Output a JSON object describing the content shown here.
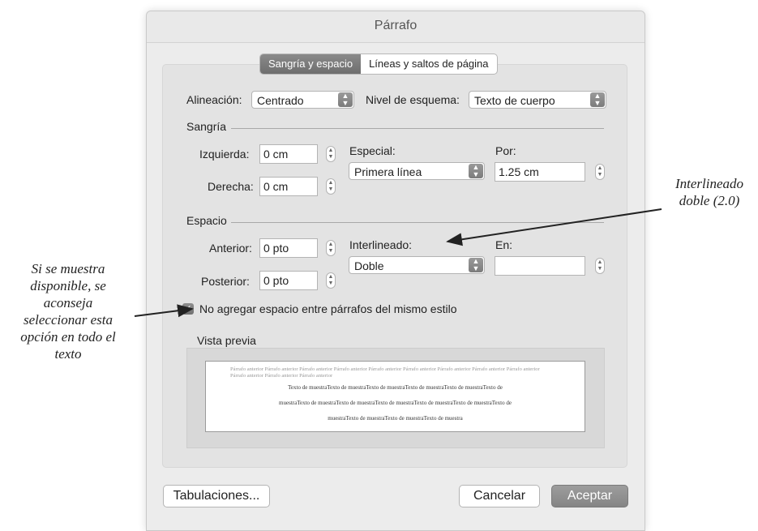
{
  "dialog": {
    "title": "Párrafo",
    "tabs": [
      {
        "label": "Sangría y espacio",
        "active": true
      },
      {
        "label": "Líneas y saltos de página",
        "active": false
      }
    ],
    "alignment": {
      "label": "Alineación:",
      "value": "Centrado"
    },
    "outline_level": {
      "label": "Nivel de esquema:",
      "value": "Texto de cuerpo"
    },
    "indentation": {
      "section": "Sangría",
      "left": {
        "label": "Izquierda:",
        "value": "0 cm"
      },
      "right": {
        "label": "Derecha:",
        "value": "0 cm"
      },
      "special": {
        "label": "Especial:",
        "value": "Primera línea"
      },
      "by": {
        "label": "Por:",
        "value": "1.25 cm"
      }
    },
    "spacing": {
      "section": "Espacio",
      "before": {
        "label": "Anterior:",
        "value": "0 pto"
      },
      "after": {
        "label": "Posterior:",
        "value": "0 pto"
      },
      "line_spacing": {
        "label": "Interlineado:",
        "value": "Doble"
      },
      "at": {
        "label": "En:",
        "value": ""
      }
    },
    "no_space_checkbox": {
      "label": "No agregar espacio entre párrafos del mismo estilo",
      "checked": true
    },
    "preview": {
      "label": "Vista previa",
      "prior_text": "Párrafo anterior Párrafo anterior Párrafo anterior Párrafo anterior Párrafo anterior Párrafo anterior Párrafo anterior Párrafo anterior Párrafo anterior Párrafo anterior Párrafo anterior Párrafo anterior",
      "sample_lines": [
        "Texto de muestraTexto de muestraTexto de muestraTexto de muestraTexto de muestraTexto de",
        "muestraTexto de muestraTexto de muestraTexto de muestraTexto de muestraTexto de muestraTexto de",
        "muestraTexto de muestraTexto de muestraTexto de muestra"
      ]
    },
    "buttons": {
      "tabs": "Tabulaciones...",
      "cancel": "Cancelar",
      "ok": "Aceptar"
    }
  },
  "annotations": {
    "line_spacing_note": [
      "Interlineado",
      "doble (2.0)"
    ],
    "checkbox_note": [
      "Si se muestra",
      "disponible, se",
      "aconseja",
      "seleccionar esta",
      "opción en todo el",
      "texto"
    ]
  },
  "colors": {
    "accent_button": "#8f8f8f",
    "dialog_bg": "#ececec"
  }
}
